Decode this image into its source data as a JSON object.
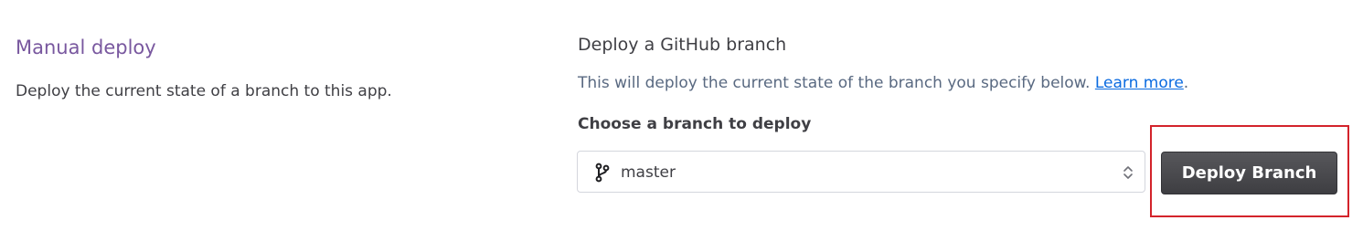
{
  "manual_deploy": {
    "title": "Manual deploy",
    "description": "Deploy the current state of a branch to this app."
  },
  "github_deploy": {
    "heading": "Deploy a GitHub branch",
    "description_prefix": "This will deploy the current state of the branch you specify below. ",
    "learn_more_label": "Learn more",
    "description_suffix": ".",
    "choose_label": "Choose a branch to deploy",
    "branch_icon": "git-branch-icon",
    "selected_branch": "master",
    "select_indicator_icon": "up-down-chevron-icon",
    "deploy_button_label": "Deploy Branch"
  },
  "colors": {
    "section_title": "#79589f",
    "link": "#0b6be0",
    "button_bg": "#4a4a4e",
    "highlight": "#d3232b"
  }
}
